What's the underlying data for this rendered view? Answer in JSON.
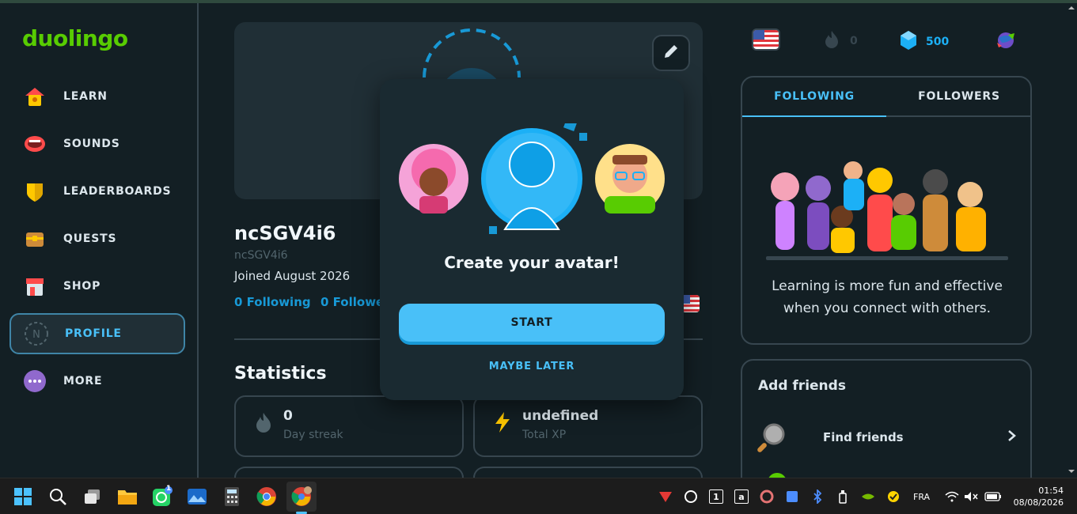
{
  "brand": {
    "logo": "duolingo",
    "accent": "#58cc02",
    "blue": "#49c0f8"
  },
  "sidebar": {
    "items": [
      {
        "label": "LEARN",
        "icon": "home-icon"
      },
      {
        "label": "SOUNDS",
        "icon": "mouth-icon"
      },
      {
        "label": "LEADERBOARDS",
        "icon": "shield-icon"
      },
      {
        "label": "QUESTS",
        "icon": "chest-icon"
      },
      {
        "label": "SHOP",
        "icon": "shop-icon"
      },
      {
        "label": "PROFILE",
        "icon": "profile-icon",
        "active": true,
        "avatar_letter": "N"
      },
      {
        "label": "MORE",
        "icon": "more-icon"
      }
    ]
  },
  "topbar": {
    "streak": "0",
    "gems": "500",
    "language": "en-flag-icon"
  },
  "profile": {
    "name": "ncSGV4i6",
    "handle": "ncSGV4i6",
    "joined": "Joined August 2026",
    "following": "0 Following",
    "followers": "0 Followers"
  },
  "statistics": {
    "title": "Statistics",
    "cards": [
      {
        "value": "0",
        "label": "Day streak",
        "icon": "flame-icon"
      },
      {
        "value": "undefined",
        "label": "Total XP",
        "icon": "lightning-icon"
      }
    ]
  },
  "follow_panel": {
    "tabs": [
      "FOLLOWING",
      "FOLLOWERS"
    ],
    "active_tab": "FOLLOWING",
    "message": "Learning is more fun and effective when you connect with others."
  },
  "friends_panel": {
    "title": "Add friends",
    "items": [
      {
        "label": "Find friends",
        "icon": "magnifier-icon"
      }
    ]
  },
  "modal": {
    "title": "Create your avatar!",
    "primary": "START",
    "secondary": "MAYBE LATER"
  },
  "taskbar": {
    "whatsapp_badge": "1",
    "lang": "FRA",
    "time": "01:54",
    "date": "08/08/2026"
  }
}
